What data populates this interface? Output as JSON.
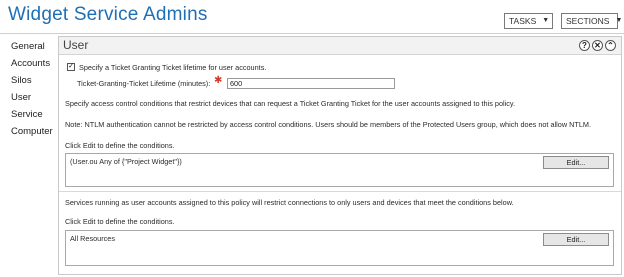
{
  "app": {
    "title": "Widget Service Admins",
    "tasks_label": "TASKS",
    "sections_label": "SECTIONS",
    "dropdown_glyph": "▼"
  },
  "sidebar": {
    "items": [
      {
        "label": "General"
      },
      {
        "label": "Accounts"
      },
      {
        "label": "Silos"
      },
      {
        "label": "User"
      },
      {
        "label": "Service"
      },
      {
        "label": "Computer"
      }
    ]
  },
  "section": {
    "title": "User",
    "help_glyph": "?",
    "collapse_glyph": "⌃",
    "close_glyph": "✕",
    "tgt_checkbox_label": "Specify a Ticket Granting Ticket lifetime for user accounts.",
    "tgt_checkbox_checked": true,
    "tgt_lifetime_label": "Ticket-Granting-Ticket Lifetime (minutes):",
    "tgt_lifetime_value": "600",
    "required_glyph": "✱",
    "access_control_text": "Specify access control conditions that restrict devices that can request a Ticket Granting Ticket for the user accounts assigned to this policy.",
    "ntlm_note": "Note: NTLM authentication cannot be restricted by access control conditions. Users should be members of the Protected Users group, which does not allow NTLM.",
    "click_edit_text_1": "Click Edit to define the conditions.",
    "condition_1": "(User.ou Any of {\"Project Widget\"})",
    "edit_label": "Edit...",
    "services_text": "Services running as user accounts assigned to this policy will restrict connections to only users and devices that meet the conditions below.",
    "click_edit_text_2": "Click Edit to define the conditions.",
    "condition_2": "All Resources"
  },
  "colors": {
    "title_blue": "#1f6fb7",
    "required_red": "#d53a2a"
  }
}
